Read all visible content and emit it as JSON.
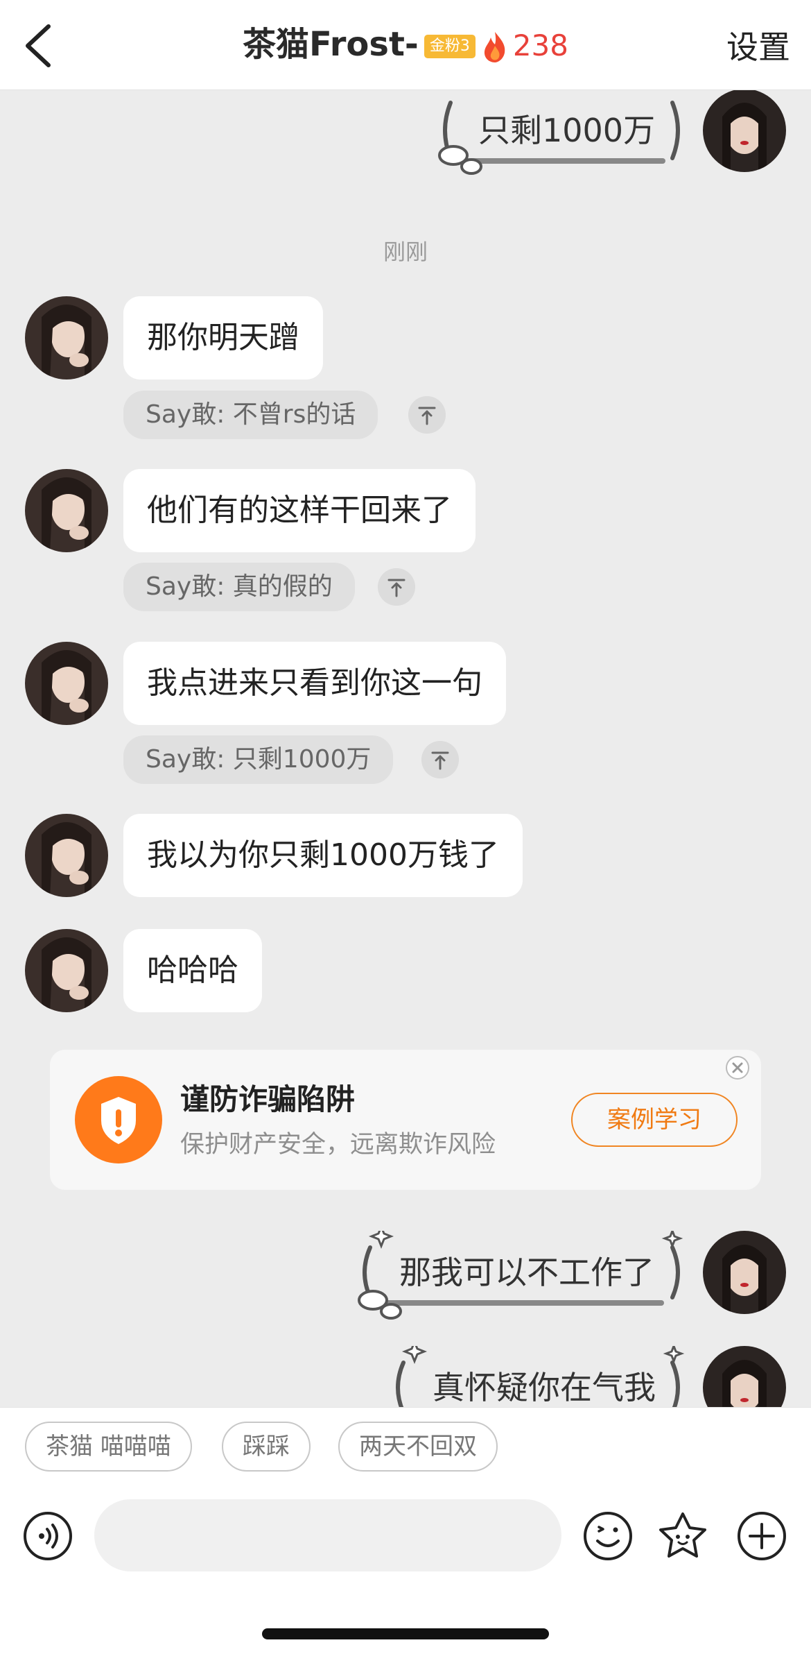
{
  "header": {
    "name": "茶猫Frost-",
    "badge": "金粉3",
    "score": "238",
    "settings": "设置"
  },
  "messages": {
    "top_sent": "只剩1000万",
    "timestamp": "刚刚",
    "m1": "那你明天蹭",
    "q1": "Say敢: 不曾rs的话",
    "m2": "他们有的这样干回来了",
    "q2": "Say敢: 真的假的",
    "m3": "我点进来只看到你这一句",
    "q3": "Say敢: 只剩1000万",
    "m4": "我以为你只剩1000万钱了",
    "m5": "哈哈哈",
    "sent1": "那我可以不工作了",
    "sent2": "真怀疑你在气我"
  },
  "alert": {
    "title": "谨防诈骗陷阱",
    "subtitle": "保护财产安全，远离欺诈风险",
    "button": "案例学习"
  },
  "quick_replies": [
    "茶猫 喵喵喵",
    "踩踩",
    "两天不回双"
  ],
  "input": {
    "placeholder": ""
  },
  "icons": [
    "back-arrow-icon",
    "flame-icon",
    "quote-up-icon",
    "shield-alert-icon",
    "close-icon",
    "voice-icon",
    "emoji-icon",
    "sticker-icon",
    "plus-icon"
  ],
  "colors": {
    "accent_orange": "#ff7a1a",
    "badge_gold": "#f7b935",
    "score_red": "#e8413a"
  }
}
